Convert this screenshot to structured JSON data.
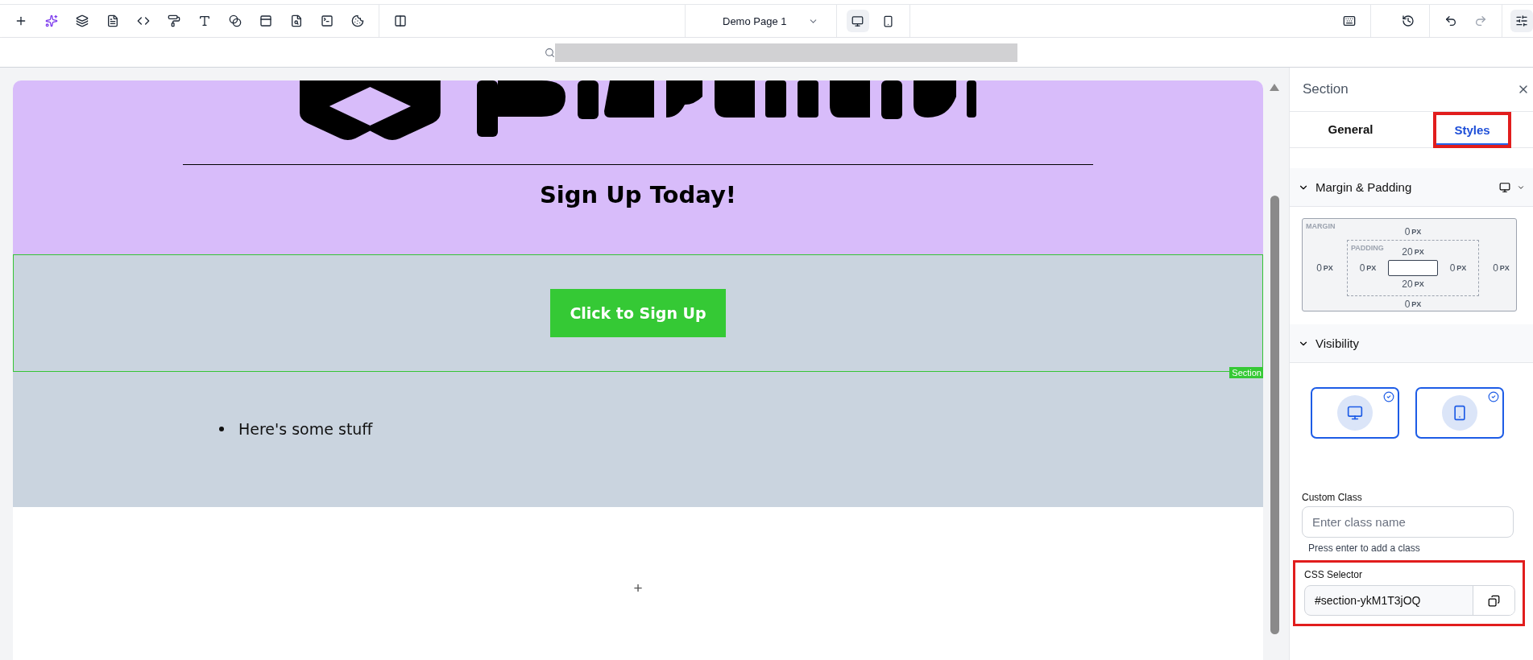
{
  "toolbar": {
    "page_name": "Demo Page 1",
    "devices": [
      {
        "kind": "desktop",
        "selected": true
      },
      {
        "kind": "mobile",
        "selected": false
      }
    ]
  },
  "canvas": {
    "heading": "Sign Up Today!",
    "button": "Click to Sign Up",
    "section_tag": "Section",
    "list_items": [
      "Here's some stuff"
    ],
    "add_symbol": "+"
  },
  "panel": {
    "title": "Section",
    "tabs": [
      {
        "label": "General",
        "selected": false,
        "highlighted": false
      },
      {
        "label": "Styles",
        "selected": true,
        "highlighted": true
      }
    ],
    "margin_padding": {
      "title": "Margin & Padding",
      "expanded": true,
      "margin_label": "MARGIN",
      "padding_label": "PADDING",
      "margin": {
        "top": {
          "value": "0",
          "unit": "PX"
        },
        "left": {
          "value": "0",
          "unit": "PX"
        },
        "right": {
          "value": "0",
          "unit": "PX"
        },
        "bottom": {
          "value": "0",
          "unit": "PX"
        }
      },
      "padding": {
        "top": {
          "value": "20",
          "unit": "PX"
        },
        "left": {
          "value": "0",
          "unit": "PX"
        },
        "right": {
          "value": "0",
          "unit": "PX"
        },
        "bottom": {
          "value": "20",
          "unit": "PX"
        }
      }
    },
    "visibility": {
      "title": "Visibility",
      "expanded": true,
      "devices": [
        {
          "kind": "desktop",
          "checked": true
        },
        {
          "kind": "mobile",
          "checked": true
        }
      ]
    },
    "custom_class": {
      "label": "Custom Class",
      "placeholder": "Enter class name",
      "hint": "Press enter to add a class"
    },
    "css_selector": {
      "label": "CSS Selector",
      "value": "#section-ykM1T3jOQ",
      "highlighted": true
    }
  }
}
